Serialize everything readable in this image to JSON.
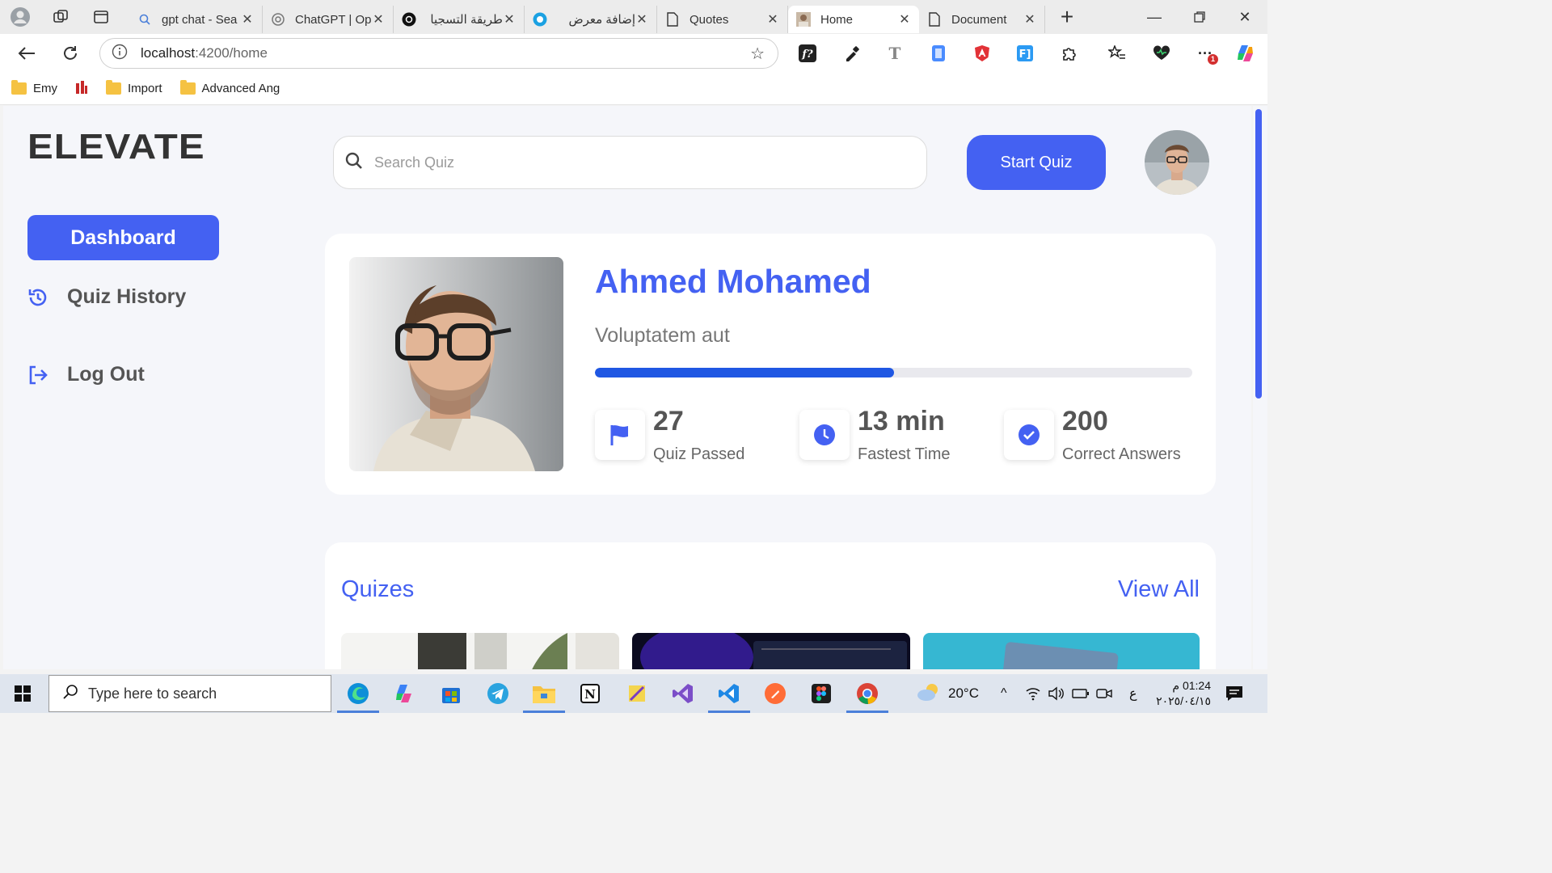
{
  "browser": {
    "tabs": [
      {
        "title": "gpt chat - Sea",
        "favicon": "search-icon"
      },
      {
        "title": "ChatGPT | Op",
        "favicon": "openai-icon"
      },
      {
        "title": "طريقة التسجيا",
        "favicon": "openai-icon"
      },
      {
        "title": "إضافة معرض",
        "favicon": "circle-app-icon"
      },
      {
        "title": "Quotes",
        "favicon": "document-icon"
      },
      {
        "title": "Home",
        "favicon": "avatar-icon",
        "active": true
      },
      {
        "title": "Document",
        "favicon": "document-icon"
      }
    ],
    "url": {
      "host": "localhost",
      "path": ":4200/home"
    },
    "bookmarks": [
      {
        "label": "Emy",
        "icon": "folder-icon"
      },
      {
        "label": "",
        "icon": "app-icon"
      },
      {
        "label": "Import",
        "icon": "folder-icon"
      },
      {
        "label": "Advanced Ang",
        "icon": "folder-icon"
      }
    ]
  },
  "app": {
    "logo": "ELEVATE",
    "sidebar": {
      "dashboard": "Dashboard",
      "quiz_history": "Quiz History",
      "logout": "Log Out"
    },
    "search": {
      "placeholder": "Search Quiz"
    },
    "start_quiz": "Start Quiz",
    "profile": {
      "name": "Ahmed Mohamed",
      "subtitle": "Voluptatem aut",
      "progress_percent": 50
    },
    "stats": [
      {
        "value": "27",
        "label": "Quiz Passed",
        "icon": "flag-icon"
      },
      {
        "value": "13 min",
        "label": "Fastest Time",
        "icon": "clock-icon"
      },
      {
        "value": "200",
        "label": "Correct Answers",
        "icon": "check-circle-icon"
      }
    ],
    "quizes": {
      "title": "Quizes",
      "view_all": "View All"
    }
  },
  "taskbar": {
    "search_placeholder": "Type here to search",
    "weather": "20°C",
    "lang": "ع",
    "time": "01:24 م",
    "date": "٢٠٢٥/٠٤/١٥"
  },
  "colors": {
    "accent": "#4461f2",
    "progress": "#1f57e3"
  }
}
